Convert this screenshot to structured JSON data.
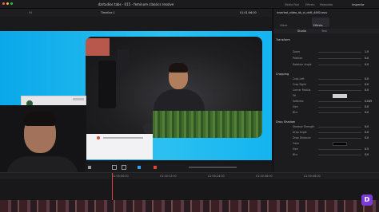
{
  "window": {
    "title": "dzstudios tabs - 015 - feminum classics resolve"
  },
  "titlebar_buttons": [
    "Media Pool",
    "Effects",
    "Edit Index",
    "Sound Library",
    "Mixer",
    "Metadata",
    "Inspector"
  ],
  "viewer": {
    "timeline_name": "Timeline 1",
    "zoom": "Fit",
    "timecode": "01:01:06:00"
  },
  "inspector": {
    "clip_name": "inverted_video_dk_ct_drift_4460.mov",
    "tabs": [
      "Video",
      "Audio",
      "Effects",
      "Transition",
      "Image",
      "File"
    ],
    "subtabs": [
      "Studio",
      "Text"
    ],
    "sections": {
      "transform": "Transform",
      "cropping": "Cropping",
      "drop_shadow": "Drop Shadow"
    },
    "transform_rows": [
      {
        "label": "Zoom",
        "value": "1.0"
      },
      {
        "label": "Position",
        "value": "0.0"
      },
      {
        "label": "Rotation Angle",
        "value": "0.0"
      }
    ],
    "cropping_rows": [
      {
        "label": "Crop Left",
        "value": "0.0"
      },
      {
        "label": "Crop Right",
        "value": "0.0"
      },
      {
        "label": "Corner Radius",
        "value": "0.0"
      },
      {
        "label": "Fill",
        "value": ""
      },
      {
        "label": "Softness",
        "value": "0.045"
      },
      {
        "label": "Size",
        "value": "0.0"
      },
      {
        "label": "Blur",
        "value": "0.0"
      }
    ],
    "shadow_rows": [
      {
        "label": "Shadow Strength",
        "value": "0.0"
      },
      {
        "label": "Drop Angle",
        "value": "0.0"
      },
      {
        "label": "Drop Distance",
        "value": "0.0"
      },
      {
        "label": "Color",
        "value": ""
      },
      {
        "label": "Size",
        "value": "0.5"
      },
      {
        "label": "Blur",
        "value": "0.0"
      }
    ]
  },
  "timeline": {
    "ruler": [
      "01:00:00:00",
      "01:00:12:00",
      "01:00:24:00",
      "01:00:36:00",
      "01:00:48:00",
      "01:01:00:00"
    ]
  },
  "colors": {
    "accent": "#7a3bd9",
    "playhead": "#e2443a",
    "canvas_bg": "#1cb4ee"
  }
}
